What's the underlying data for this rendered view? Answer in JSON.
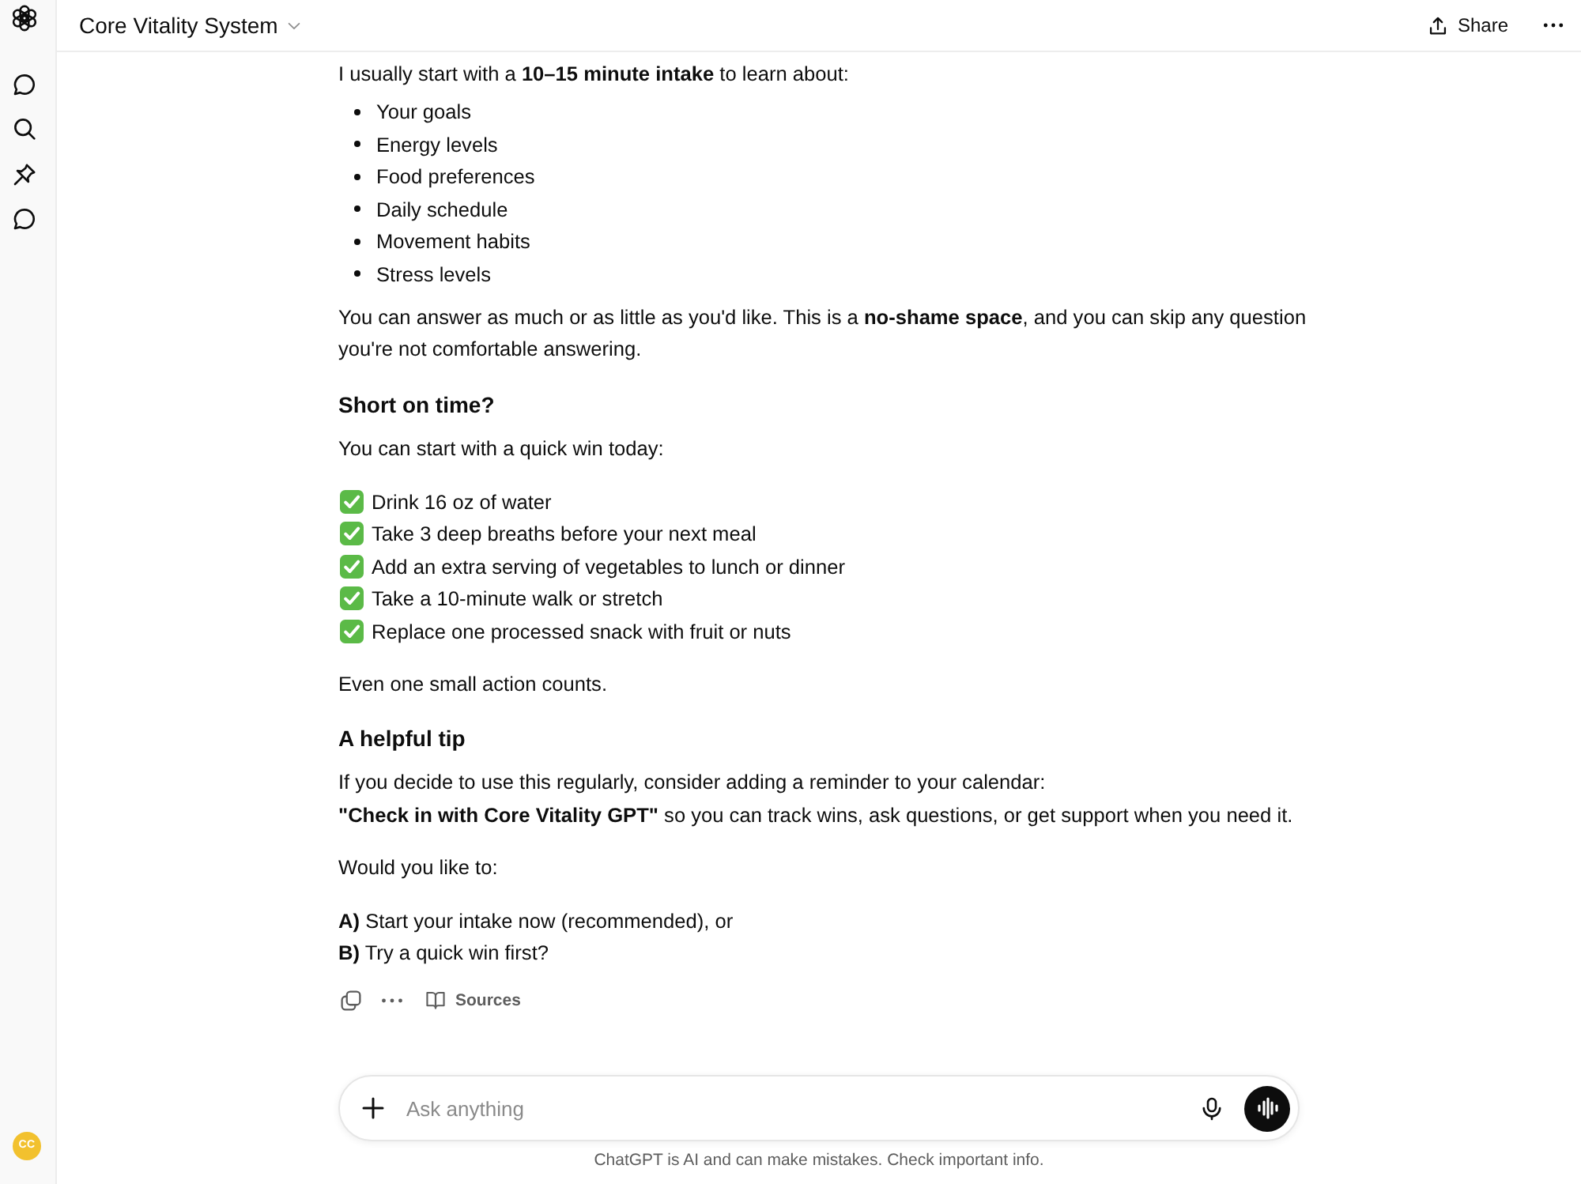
{
  "sidebar": {
    "avatar": "CC"
  },
  "header": {
    "title": "Core Vitality System",
    "share": "Share"
  },
  "message": {
    "blocks": [
      {
        "kind": "paragraph",
        "lines": [
          "I usually start with a **10–15 minute intake** to learn about:"
        ]
      },
      {
        "kind": "bullets",
        "items": [
          "Your goals",
          "Energy levels",
          "Food preferences",
          "Daily schedule",
          "Movement habits",
          "Stress levels"
        ]
      },
      {
        "kind": "paragraph",
        "lines": [
          "You can answer as much or as little as you'd like. This is a **no-shame space**, and you can skip any question you're not comfortable answering."
        ]
      },
      {
        "kind": "heading",
        "text": "Short on time?"
      },
      {
        "kind": "paragraph",
        "lines": [
          "You can start with a quick win today:"
        ]
      },
      {
        "kind": "checklist",
        "items": [
          "Drink 16 oz of water",
          "Take 3 deep breaths before your next meal",
          "Add an extra serving of vegetables to lunch or dinner",
          "Take a 10-minute walk or stretch",
          "Replace one processed snack with fruit or nuts"
        ]
      },
      {
        "kind": "paragraph",
        "lines": [
          "Even one small action counts."
        ]
      },
      {
        "kind": "heading",
        "text": "A helpful tip"
      },
      {
        "kind": "paragraph",
        "lines": [
          "If you decide to use this regularly, consider adding a reminder to your calendar:",
          "**\"Check in with Core Vitality GPT\"** so you can track wins, ask questions, or get support when you need it."
        ]
      },
      {
        "kind": "paragraph",
        "lines": [
          "Would you like to:"
        ]
      },
      {
        "kind": "paragraph",
        "lines": [
          "**A)** Start your intake now (recommended), or",
          "**B)** Try a quick win first?"
        ]
      }
    ],
    "actions": {
      "sources": "Sources"
    }
  },
  "composer": {
    "placeholder": "Ask anything"
  },
  "footer": "ChatGPT is AI and can make mistakes. Check important info."
}
